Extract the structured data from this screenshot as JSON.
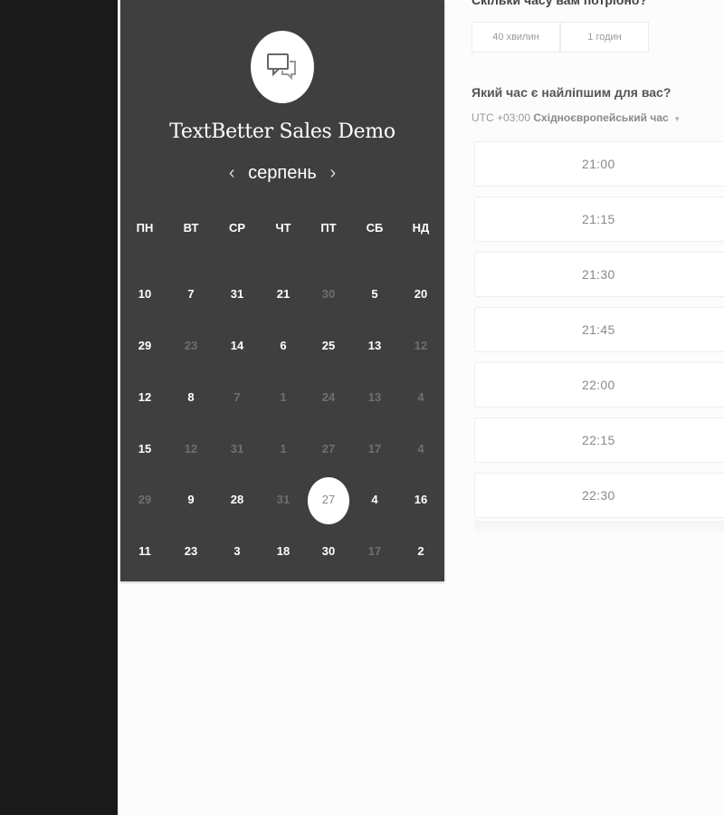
{
  "calendar": {
    "title": "TextBetter Sales Demo",
    "month": "серпень",
    "prev_icon": "‹",
    "next_icon": "›",
    "weekdays": [
      "ПН",
      "ВТ",
      "СР",
      "ЧТ",
      "ПТ",
      "СБ",
      "НД"
    ],
    "weeks": [
      [
        {
          "d": "10",
          "f": false
        },
        {
          "d": "7",
          "f": false
        },
        {
          "d": "31",
          "f": false
        },
        {
          "d": "21",
          "f": false
        },
        {
          "d": "30",
          "f": true
        },
        {
          "d": "5",
          "f": false
        },
        {
          "d": "20",
          "f": false
        }
      ],
      [
        {
          "d": "29",
          "f": false
        },
        {
          "d": "23",
          "f": true
        },
        {
          "d": "14",
          "f": false
        },
        {
          "d": "6",
          "f": false
        },
        {
          "d": "25",
          "f": false
        },
        {
          "d": "13",
          "f": false
        },
        {
          "d": "12",
          "f": true
        }
      ],
      [
        {
          "d": "12",
          "f": false
        },
        {
          "d": "8",
          "f": false
        },
        {
          "d": "7",
          "f": true
        },
        {
          "d": "1",
          "f": true
        },
        {
          "d": "24",
          "f": true
        },
        {
          "d": "13",
          "f": true
        },
        {
          "d": "4",
          "f": true
        }
      ],
      [
        {
          "d": "15",
          "f": false
        },
        {
          "d": "12",
          "f": true
        },
        {
          "d": "31",
          "f": true
        },
        {
          "d": "1",
          "f": true
        },
        {
          "d": "27",
          "f": true
        },
        {
          "d": "17",
          "f": true
        },
        {
          "d": "4",
          "f": true
        }
      ],
      [
        {
          "d": "29",
          "f": true
        },
        {
          "d": "9",
          "f": false
        },
        {
          "d": "28",
          "f": false
        },
        {
          "d": "31",
          "f": true
        },
        {
          "d": "27",
          "f": false,
          "sel": true
        },
        {
          "d": "4",
          "f": false
        },
        {
          "d": "16",
          "f": false
        }
      ],
      [
        {
          "d": "11",
          "f": false
        },
        {
          "d": "23",
          "f": false
        },
        {
          "d": "3",
          "f": false
        },
        {
          "d": "18",
          "f": false
        },
        {
          "d": "30",
          "f": false
        },
        {
          "d": "17",
          "f": true
        },
        {
          "d": "2",
          "f": false
        }
      ]
    ],
    "selected_day": "27"
  },
  "duration": {
    "heading": "Скільки часу вам потрібно?",
    "options": [
      "40 хвилин",
      "1 годин"
    ]
  },
  "time": {
    "heading": "Який час є найліпшим для вас?",
    "timezone_offset": "UTC +03:00",
    "timezone_name": "Східноєвропейський час",
    "slots": [
      "21:00",
      "21:15",
      "21:30",
      "21:45",
      "22:00",
      "22:15",
      "22:30"
    ]
  },
  "icons": {
    "avatar": "chat-bubbles-icon",
    "tz_caret": "caret-down-icon"
  }
}
